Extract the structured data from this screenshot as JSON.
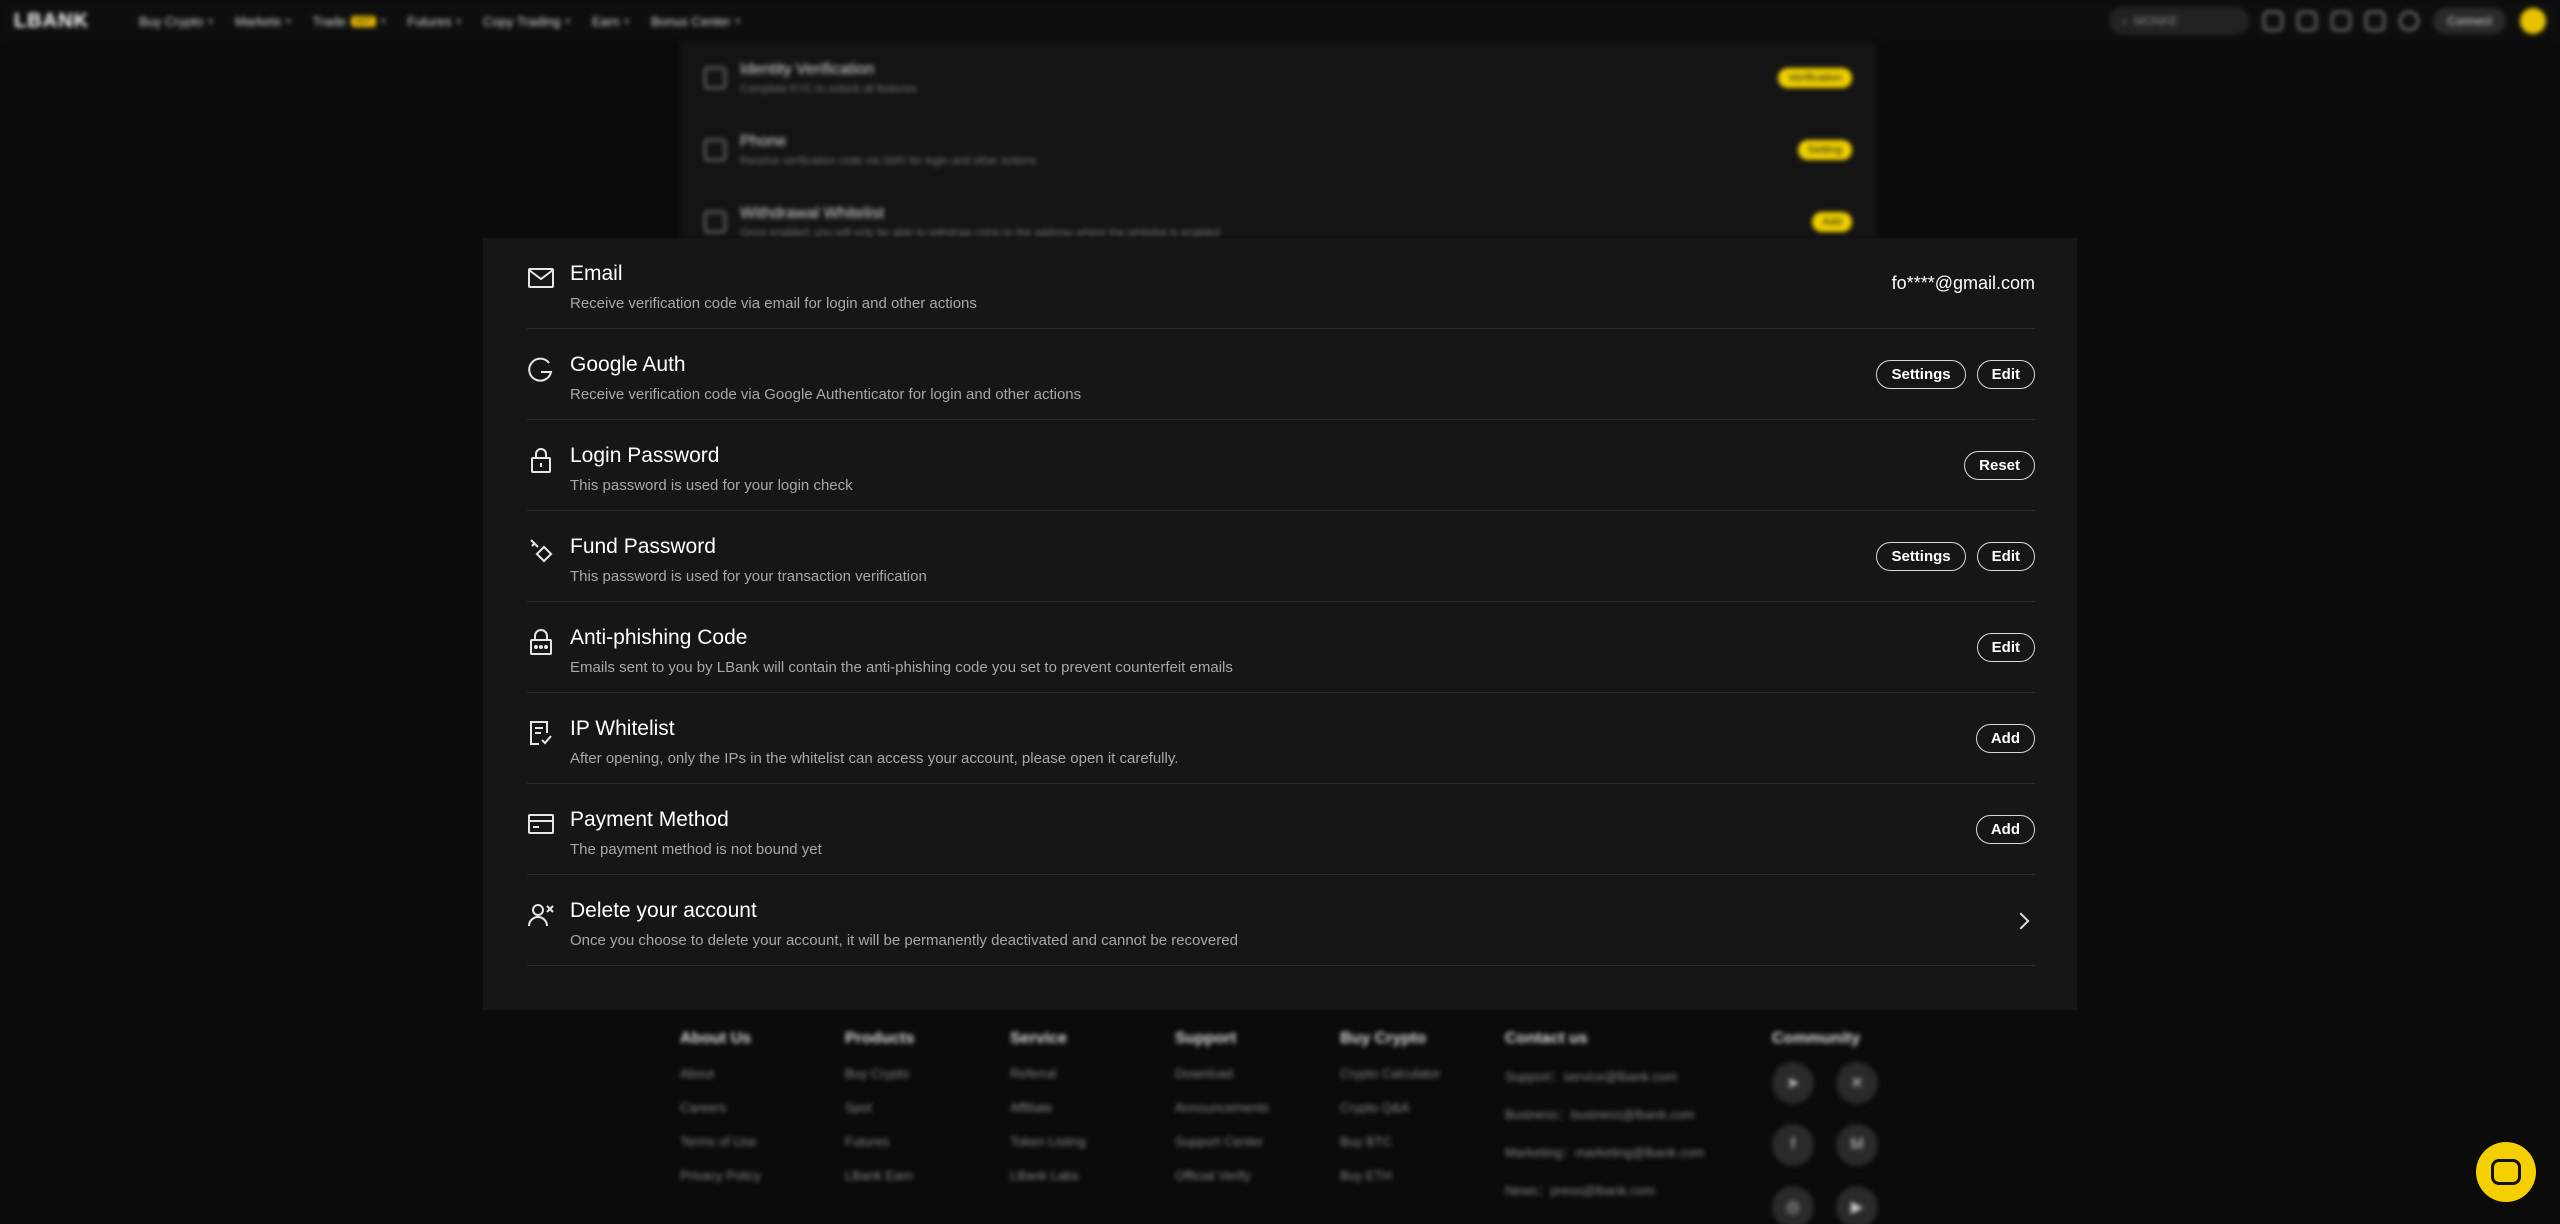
{
  "nav": {
    "logo": "LBANK",
    "items": [
      {
        "label": "Buy Crypto"
      },
      {
        "label": "Markets"
      },
      {
        "label": "Trade",
        "badge": "HOT"
      },
      {
        "label": "Futures"
      },
      {
        "label": "Copy Trading"
      },
      {
        "label": "Earn"
      },
      {
        "label": "Bonus Center"
      }
    ],
    "search_placeholder": "MONKE",
    "connect_label": "Connect"
  },
  "background_rows": [
    {
      "title": "Identity Verification",
      "sub": "Complete KYC to unlock all features",
      "badge": "Verification"
    },
    {
      "title": "Phone",
      "sub": "Receive verification code via SMS for login and other actions",
      "badge": "Setting"
    },
    {
      "title": "Withdrawal Whitelist",
      "sub": "Once enabled, you will only be able to withdraw coins to the address where the whitelist is enabled",
      "badge": "Add"
    }
  ],
  "security": {
    "rows": [
      {
        "icon": "email-icon",
        "title": "Email",
        "sub": "Receive verification code via email for login and other actions",
        "value": "fo****@gmail.com"
      },
      {
        "icon": "google-auth-icon",
        "title": "Google Auth",
        "sub": "Receive verification code via Google Authenticator for login and other actions",
        "buttons": [
          "Settings",
          "Edit"
        ]
      },
      {
        "icon": "lock-icon",
        "title": "Login Password",
        "sub": "This password is used for your login check",
        "buttons": [
          "Reset"
        ]
      },
      {
        "icon": "key-icon",
        "title": "Fund Password",
        "sub": "This password is used for your transaction verification",
        "buttons": [
          "Settings",
          "Edit"
        ]
      },
      {
        "icon": "anti-phishing-icon",
        "title": "Anti-phishing Code",
        "sub": "Emails sent to you by LBank will contain the anti-phishing code you set to prevent counterfeit emails",
        "buttons": [
          "Edit"
        ]
      },
      {
        "icon": "ip-whitelist-icon",
        "title": "IP Whitelist",
        "sub": "After opening, only the IPs in the whitelist can access your account, please open it carefully.",
        "buttons": [
          "Add"
        ]
      },
      {
        "icon": "payment-card-icon",
        "title": "Payment Method",
        "sub": "The payment method is not bound yet",
        "buttons": [
          "Add"
        ]
      },
      {
        "icon": "delete-user-icon",
        "title": "Delete your account",
        "sub": "Once you choose to delete your account, it will be permanently deactivated and cannot be recovered"
      }
    ]
  },
  "footer": {
    "columns": [
      {
        "heading": "About Us",
        "items": [
          "About",
          "Careers",
          "Terms of Use",
          "Privacy Policy"
        ]
      },
      {
        "heading": "Products",
        "items": [
          "Buy Crypto",
          "Spot",
          "Futures",
          "LBank Earn"
        ]
      },
      {
        "heading": "Service",
        "items": [
          "Referral",
          "Affiliate",
          "Token Listing",
          "LBank Labs"
        ]
      },
      {
        "heading": "Support",
        "items": [
          "Download",
          "Announcements",
          "Support Center",
          "Official Verify"
        ]
      },
      {
        "heading": "Buy Crypto",
        "items": [
          "Crypto Calculator",
          "Crypto Q&A",
          "Buy BTC",
          "Buy ETH"
        ]
      },
      {
        "heading": "Contact us",
        "items": [
          "Support：service@lbank.com",
          "Business：business@lbank.com",
          "Marketing：marketing@lbank.com",
          "News：press@lbank.com"
        ]
      }
    ],
    "community_heading": "Community"
  },
  "colors": {
    "accent": "#f0d000",
    "panel": "#161616",
    "background": "#0b0b0b"
  }
}
